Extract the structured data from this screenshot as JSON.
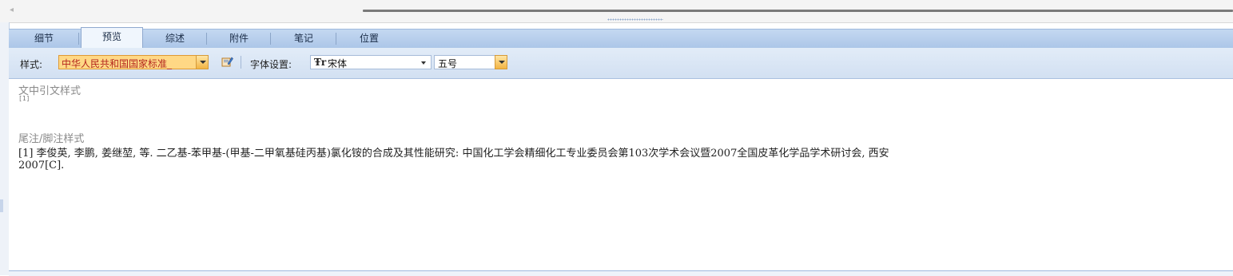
{
  "scrollbar": {
    "left_arrow": "◂"
  },
  "tabs": [
    {
      "label": "细节"
    },
    {
      "label": "预览"
    },
    {
      "label": "综述"
    },
    {
      "label": "附件"
    },
    {
      "label": "笔记"
    },
    {
      "label": "位置"
    }
  ],
  "active_tab": "预览",
  "toolbar": {
    "style_label": "样式:",
    "style_value": "中华人民共和国国家标准_",
    "font_settings_label": "字体设置:",
    "font_icon_glyph": "Ŧr",
    "font_value": "宋体",
    "size_value": "五号"
  },
  "content": {
    "intext_title": "文中引文样式",
    "intext_example": "[1]",
    "footnote_title": "尾注/脚注样式",
    "reference_line1": "[1]    李俊英, 李鹏, 姜继堃, 等. 二乙基-苯甲基-(甲基-二甲氧基硅丙基)氯化铵的合成及其性能研究: 中国化工学会精细化工专业委员会第103次学术会议暨2007全国皮革化学品学术研讨会, 西安",
    "reference_line2": "2007[C]."
  },
  "colors": {
    "accent_orange": "#ffd885",
    "tab_blue": "#acc6e8",
    "style_text": "#b3261e"
  }
}
